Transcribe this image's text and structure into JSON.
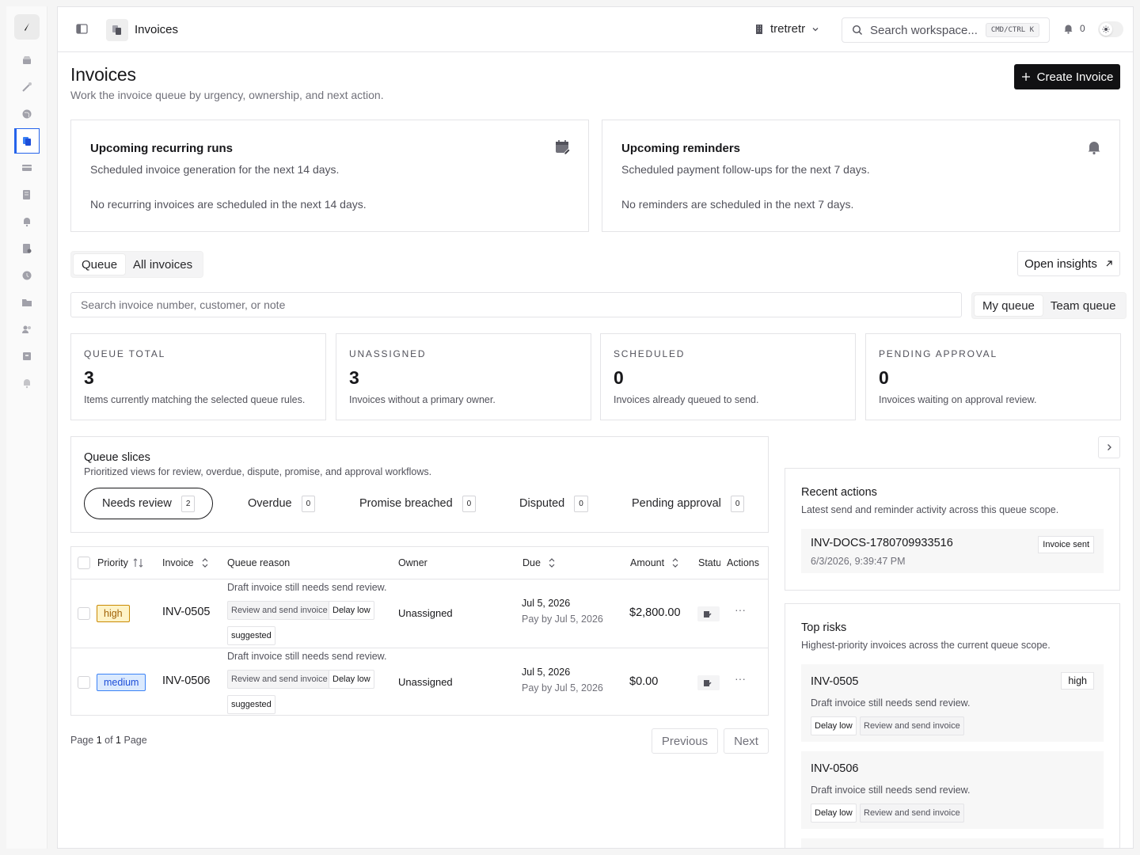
{
  "header": {
    "title": "Invoices",
    "workspace": "tretretr",
    "search_placeholder": "Search workspace...",
    "shortcut": "CMD/CTRL K",
    "notifications": "0"
  },
  "page": {
    "title": "Invoices",
    "subtitle": "Work the invoice queue by urgency, ownership, and next action.",
    "create_label": "Create Invoice"
  },
  "recurring": {
    "title": "Upcoming recurring runs",
    "desc": "Scheduled invoice generation for the next 14 days.",
    "empty": "No recurring invoices are scheduled in the next 14 days."
  },
  "reminders": {
    "title": "Upcoming reminders",
    "desc": "Scheduled payment follow-ups for the next 7 days.",
    "empty": "No reminders are scheduled in the next 7 days."
  },
  "view_tabs": [
    "Queue",
    "All invoices"
  ],
  "open_insights": "Open insights",
  "invoice_search_placeholder": "Search invoice number, customer, or note",
  "queue_scope": [
    "My queue",
    "Team queue"
  ],
  "stats": [
    {
      "label": "QUEUE TOTAL",
      "value": "3",
      "desc": "Items currently matching the selected queue rules."
    },
    {
      "label": "UNASSIGNED",
      "value": "3",
      "desc": "Invoices without a primary owner."
    },
    {
      "label": "SCHEDULED",
      "value": "0",
      "desc": "Invoices already queued to send."
    },
    {
      "label": "PENDING APPROVAL",
      "value": "0",
      "desc": "Invoices waiting on approval review."
    }
  ],
  "slices": {
    "title": "Queue slices",
    "desc": "Prioritized views for review, overdue, dispute, promise, and approval workflows.",
    "items": [
      {
        "label": "Needs review",
        "count": "2"
      },
      {
        "label": "Overdue",
        "count": "0"
      },
      {
        "label": "Promise breached",
        "count": "0"
      },
      {
        "label": "Disputed",
        "count": "0"
      },
      {
        "label": "Pending approval",
        "count": "0"
      }
    ]
  },
  "table": {
    "headers": [
      "Priority",
      "Invoice",
      "Queue reason",
      "Owner",
      "Due",
      "Amount",
      "Statu",
      "Actions"
    ],
    "rows": [
      {
        "priority": "high",
        "invoice": "INV-0505",
        "reason": "Draft invoice still needs send review.",
        "tag1": "Review and send invoice",
        "tag2": "Delay low",
        "tag3": "suggested",
        "owner": "Unassigned",
        "due": "Jul 5, 2026",
        "pay_by": "Pay by Jul 5, 2026",
        "amount": "$2,800.00",
        "actions": "···"
      },
      {
        "priority": "medium",
        "invoice": "INV-0506",
        "reason": "Draft invoice still needs send review.",
        "tag1": "Review and send invoice",
        "tag2": "Delay low",
        "tag3": "suggested",
        "owner": "Unassigned",
        "due": "Jul 5, 2026",
        "pay_by": "Pay by Jul 5, 2026",
        "amount": "$0.00",
        "actions": "···"
      }
    ]
  },
  "pager": {
    "prefix": "Page",
    "current": "1",
    "of": "of",
    "total": "1",
    "suffix": "Page",
    "previous": "Previous",
    "next": "Next"
  },
  "recent": {
    "title": "Recent actions",
    "desc": "Latest send and reminder activity across this queue scope.",
    "items": [
      {
        "invoice": "INV-DOCS-1780709933516",
        "time": "6/3/2026, 9:39:47 PM",
        "badge": "Invoice sent"
      }
    ]
  },
  "risks": {
    "title": "Top risks",
    "desc": "Highest-priority invoices across the current queue scope.",
    "items": [
      {
        "invoice": "INV-0505",
        "priority": "high",
        "reason": "Draft invoice still needs send review.",
        "tag1": "Delay low",
        "tag2": "Review and send invoice"
      },
      {
        "invoice": "INV-0506",
        "priority": "",
        "reason": "Draft invoice still needs send review.",
        "tag1": "Delay low",
        "tag2": "Review and send invoice"
      }
    ]
  },
  "colors": {
    "accent": "#2563eb",
    "primary_btn": "#111113",
    "high_bg": "#fef3c7",
    "medium_bg": "#dbeafe"
  }
}
